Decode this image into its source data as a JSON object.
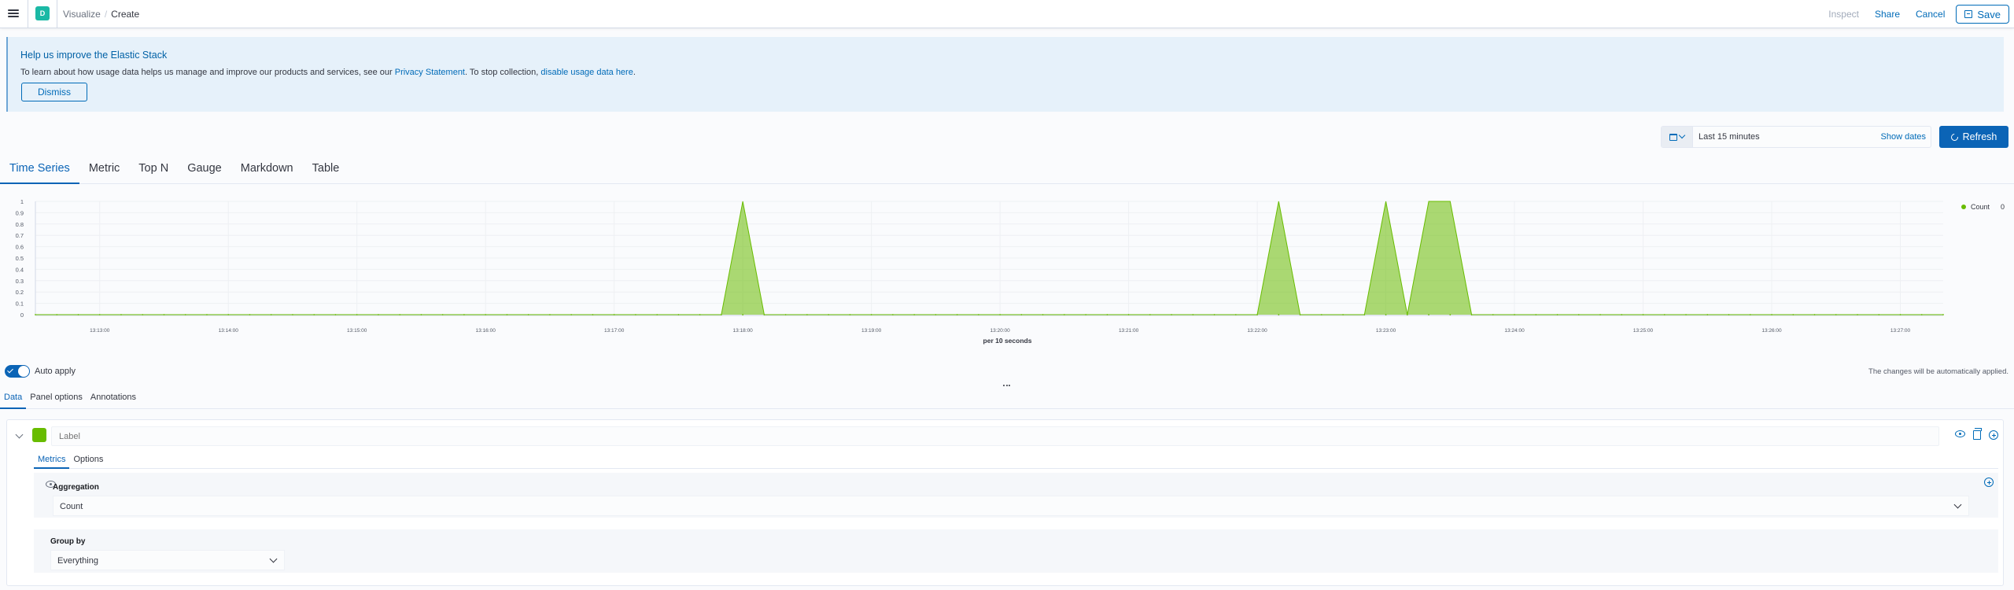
{
  "header": {
    "space_initial": "D",
    "breadcrumbs": [
      "Visualize",
      "Create"
    ],
    "actions": {
      "inspect": "Inspect",
      "share": "Share",
      "cancel": "Cancel",
      "save": "Save"
    }
  },
  "callout": {
    "title": "Help us improve the Elastic Stack",
    "text_before": "To learn about how usage data helps us manage and improve our products and services, see our ",
    "privacy_link": "Privacy Statement",
    "text_middle": ". To stop collection, ",
    "disable_link": "disable usage data here",
    "text_after": ".",
    "dismiss": "Dismiss"
  },
  "timepicker": {
    "range": "Last 15 minutes",
    "show_dates": "Show dates",
    "refresh": "Refresh"
  },
  "vis_tabs": [
    "Time Series",
    "Metric",
    "Top N",
    "Gauge",
    "Markdown",
    "Table"
  ],
  "chart_data": {
    "type": "area",
    "xlabel": "per 10 seconds",
    "ylabel": "",
    "ylim": [
      0,
      1
    ],
    "y_ticks": [
      "0",
      "0.1",
      "0.2",
      "0.3",
      "0.4",
      "0.5",
      "0.6",
      "0.7",
      "0.8",
      "0.9",
      "1"
    ],
    "x_ticks": [
      "13:13:00",
      "13:14:00",
      "13:15:00",
      "13:16:00",
      "13:17:00",
      "13:18:00",
      "13:19:00",
      "13:20:00",
      "13:21:00",
      "13:22:00",
      "13:23:00",
      "13:24:00",
      "13:25:00",
      "13:26:00",
      "13:27:00"
    ],
    "x_start": "13:12:30",
    "x_end": "13:27:20",
    "series": [
      {
        "name": "Count",
        "color": "#68bc00",
        "points": [
          [
            "13:17:50",
            0
          ],
          [
            "13:18:00",
            1
          ],
          [
            "13:18:10",
            0
          ],
          [
            "13:22:00",
            0
          ],
          [
            "13:22:10",
            1
          ],
          [
            "13:22:20",
            0
          ],
          [
            "13:22:50",
            0
          ],
          [
            "13:23:00",
            1
          ],
          [
            "13:23:10",
            0
          ],
          [
            "13:23:20",
            1
          ],
          [
            "13:23:30",
            1
          ],
          [
            "13:23:40",
            0
          ]
        ]
      }
    ],
    "legend": {
      "label": "Count",
      "value": "0",
      "position": "top-right"
    },
    "grid": true
  },
  "auto_apply": {
    "label": "Auto apply",
    "note": "The changes will be automatically applied."
  },
  "editor_tabs": [
    "Data",
    "Panel options",
    "Annotations"
  ],
  "series": {
    "color": "#68bc00",
    "label_placeholder": "Label",
    "sub_tabs": [
      "Metrics",
      "Options"
    ],
    "aggregation_label": "Aggregation",
    "aggregation_value": "Count",
    "group_by_label": "Group by",
    "group_by_value": "Everything"
  }
}
